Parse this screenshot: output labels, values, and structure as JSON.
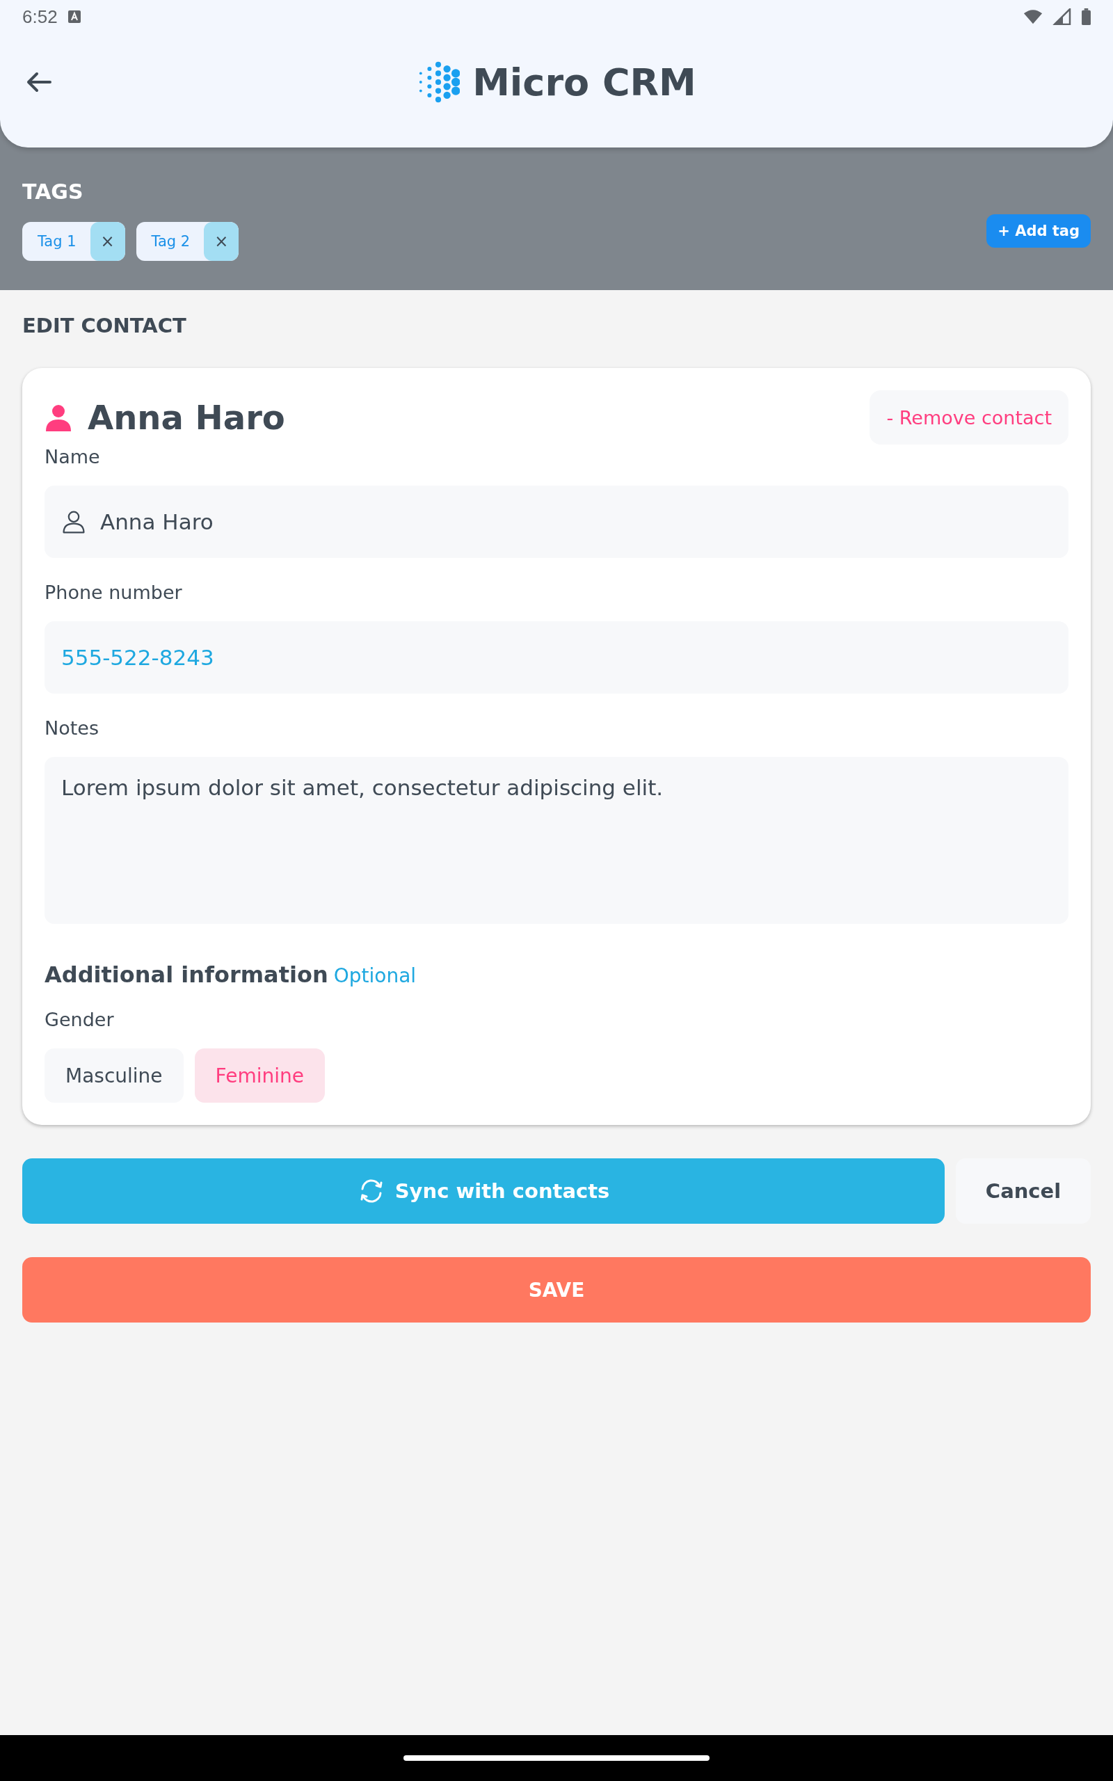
{
  "status_bar": {
    "time": "6:52"
  },
  "header": {
    "title": "Micro CRM"
  },
  "tags": {
    "title": "TAGS",
    "add_button": "+ Add tag",
    "items": [
      {
        "label": "Tag 1",
        "remove": "×"
      },
      {
        "label": "Tag 2",
        "remove": "×"
      }
    ]
  },
  "section_title": "EDIT CONTACT",
  "contact": {
    "name": "Anna Haro",
    "remove_button": "- Remove contact",
    "fields": [
      {
        "kind": "name",
        "label": "Name",
        "value": "Anna Haro"
      },
      {
        "kind": "phone",
        "label": "Phone number",
        "value": "555-522-8243"
      },
      {
        "kind": "notes",
        "label": "Notes",
        "value": "Lorem ipsum dolor sit amet, consectetur adipiscing elit."
      }
    ],
    "additional": {
      "title": "Additional information",
      "badge": "Optional",
      "gender_label": "Gender",
      "options": [
        {
          "label": "Masculine",
          "selected": false
        },
        {
          "label": "Feminine",
          "selected": true
        }
      ]
    }
  },
  "actions": {
    "sync": "Sync with contacts",
    "cancel": "Cancel",
    "save": "SAVE"
  }
}
